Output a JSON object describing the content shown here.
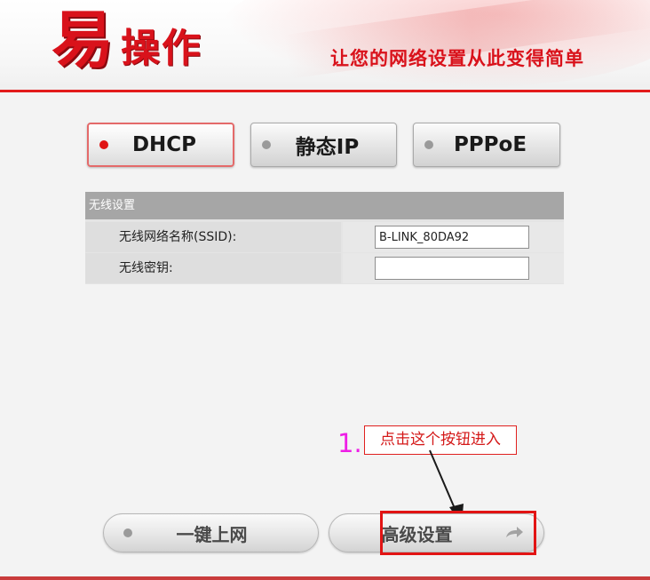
{
  "header": {
    "logo_char": "易",
    "logo_text": "操作",
    "slogan": "让您的网络设置从此变得简单"
  },
  "modes": {
    "dhcp": "DHCP",
    "static_ip": "静态IP",
    "pppoe": "PPPoE",
    "selected": "DHCP"
  },
  "wireless": {
    "title": "无线设置",
    "ssid_label": "无线网络名称(SSID):",
    "ssid_value": "B-LINK_80DA92",
    "key_label": "无线密钥:",
    "key_value": ""
  },
  "annotation": {
    "number": "1.",
    "text": "点击这个按钮进入"
  },
  "buttons": {
    "one_click": "一键上网",
    "advanced": "高级设置"
  },
  "colors": {
    "brand_red": "#d9121b",
    "annotation_magenta": "#ee1ee6",
    "active_dot": "#e01414",
    "inactive_dot": "#9a9a9a",
    "panel_header": "#a6a6a6"
  },
  "icons": {
    "advanced_button": "arrow-right-icon",
    "annotation_pointer": "annotation-arrow-icon"
  }
}
